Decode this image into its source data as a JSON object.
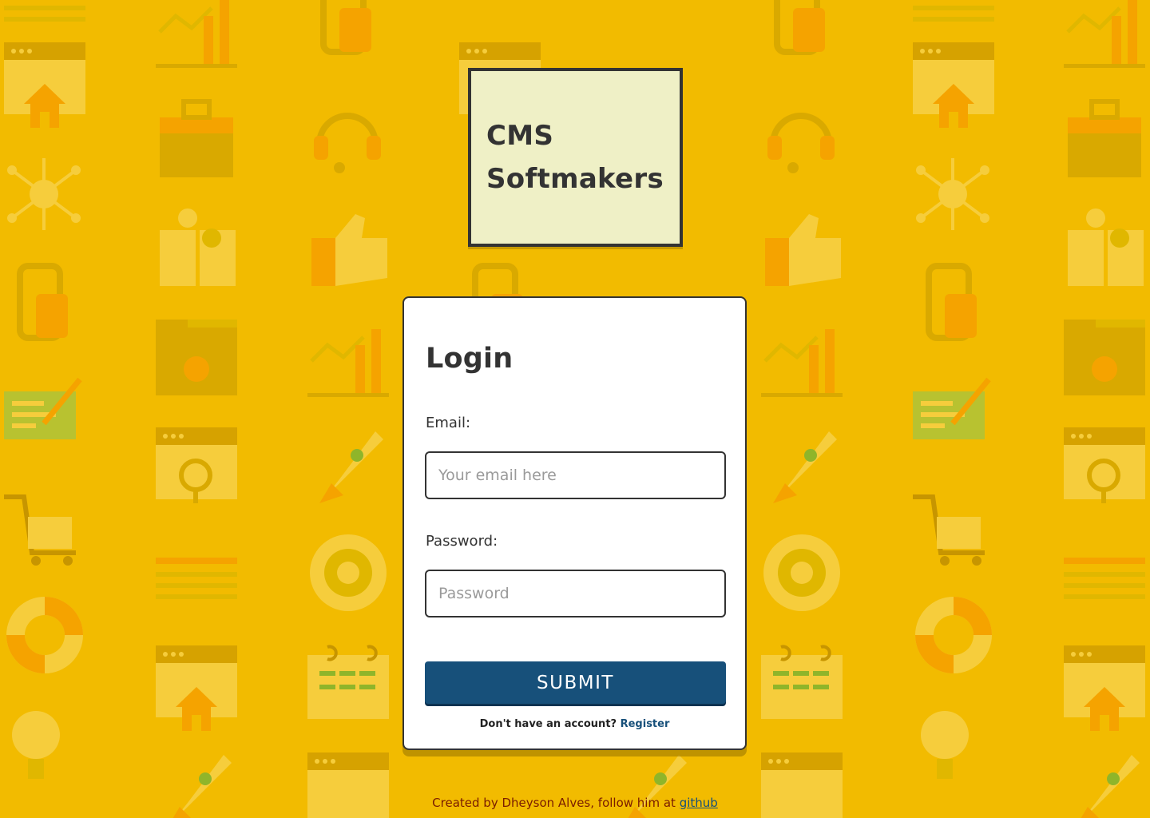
{
  "logo": {
    "line1": "CMS",
    "line2": "Softmakers"
  },
  "login": {
    "title": "Login",
    "email_label": "Email:",
    "email_placeholder": "Your email here",
    "password_label": "Password:",
    "password_placeholder": "Password",
    "submit_label": "SUBMIT",
    "register_prompt": "Don't have an account?",
    "register_link": "Register"
  },
  "footer": {
    "text": "Created by Dheyson Alves, follow him at",
    "link": "github"
  },
  "colors": {
    "background": "#f2bb00",
    "logo_bg": "#eff0c6",
    "accent": "#17507a",
    "footer_text": "#7a1c00"
  },
  "background_icons": [
    "browser-window-icon",
    "home-icon",
    "toolbox-icon",
    "network-icon",
    "headset-icon",
    "puzzle-icon",
    "thumbs-up-icon",
    "mobile-icon",
    "chart-icon",
    "gear-icon",
    "rocket-icon",
    "cart-icon",
    "globe-icon",
    "lifebuoy-icon",
    "calendar-icon",
    "magnifier-icon",
    "document-edit-icon",
    "lightbulb-icon"
  ]
}
